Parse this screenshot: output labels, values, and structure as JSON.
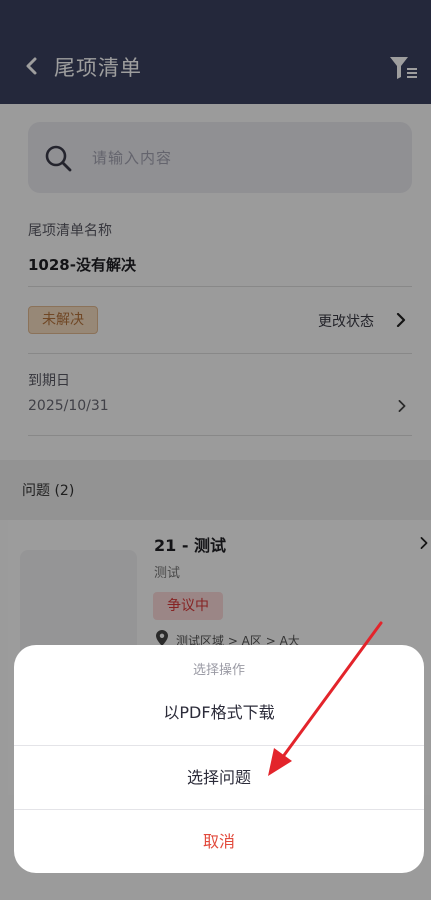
{
  "header": {
    "title": "尾项清单"
  },
  "search": {
    "placeholder": "请输入内容"
  },
  "list_name": {
    "label": "尾项清单名称",
    "value": "1028-没有解决"
  },
  "status": {
    "badge": "未解决",
    "change_label": "更改状态"
  },
  "due_date": {
    "label": "到期日",
    "value": "2025/10/31"
  },
  "issues": {
    "title": "问题 (2)",
    "items": [
      {
        "title": "21 - 测试",
        "subtitle": "测试",
        "badge": "争议中",
        "location": "测试区域 > A区 > A大"
      }
    ]
  },
  "action_sheet": {
    "title": "选择操作",
    "items": [
      "以PDF格式下载",
      "选择问题"
    ],
    "cancel": "取消"
  },
  "colors": {
    "header_bg": "#3b4260",
    "status_badge_bg": "#f4dcc0",
    "dispute_badge_bg": "#fbd8d8",
    "cancel_text": "#e24a3c",
    "annotation_arrow": "#e3242b"
  },
  "icons": [
    "back-icon",
    "filter-icon",
    "search-icon",
    "chevron-right-icon",
    "location-pin-icon"
  ]
}
